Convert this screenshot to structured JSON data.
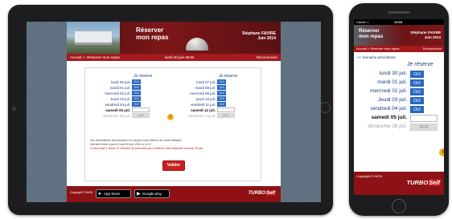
{
  "header": {
    "title_line1": "Réserver",
    "title_line2": "mon repas",
    "user_name": "Stéphane FAIVRE",
    "user_period": "Juin 2014"
  },
  "nav": {
    "home": "Accueil",
    "sep": ">",
    "current": "Réserver mon repas",
    "date": "lundi 30 juin 09:56",
    "logout": "Déconnexion"
  },
  "reservation": {
    "column_header": "Je réserve",
    "choice_yes": "OUI",
    "choice_no": "NON",
    "left_column": [
      {
        "day": "lundi 30 juin",
        "choice": "OUI"
      },
      {
        "day": "mardi 01 juil.",
        "choice": "OUI"
      },
      {
        "day": "mercredi 02 juil.",
        "choice": "OUI"
      },
      {
        "day": "Jeudi 03 juil.",
        "choice": "OUI"
      },
      {
        "day": "vendredi 04 juil.",
        "choice": "OUI"
      },
      {
        "day": "samedi 05 juil.",
        "choice": ""
      },
      {
        "day": "dimanche 06 juil.",
        "choice": "NON"
      }
    ],
    "right_column": [
      {
        "day": "lundi 07 juil.",
        "choice": "OUI"
      },
      {
        "day": "mardi 08 juil.",
        "choice": "OUI"
      },
      {
        "day": "mercredi 09 juil.",
        "choice": "OUI"
      },
      {
        "day": "jeudi 10 juil.",
        "choice": "OUI"
      },
      {
        "day": "vendredi 11 juil.",
        "choice": "OUI"
      },
      {
        "day": "samedi 12 juil.",
        "choice": ""
      },
      {
        "day": "dimanche 13 juil.",
        "choice": "NON"
      }
    ],
    "info_symbol": "i",
    "notes": [
      "Vos réservations seront prises en compte sous réserve de solde suffisant",
      "Dernière mise à jour le lundi 30 juin 2014 à 12:47",
      "Il vous reste 1 heure 37 minutes 02 secondes pour réserver votre déjeuner du lundi 30 juin"
    ],
    "submit_label": "Valider"
  },
  "footer": {
    "copyright": "Copyright © INCB",
    "appstore": "App Store",
    "googleplay": "Google play",
    "logo_main": "TURBO",
    "logo_sub": "Self"
  },
  "phone": {
    "carrier": "Carrier ≈",
    "time": "13:03",
    "nav_home": "Accueil",
    "nav_current": "Réserver mon repas",
    "logout": "Déconnexion",
    "prev_week": "<< Semaine précédente",
    "rows": [
      {
        "day": "lundi 30 juil.",
        "choice": "OUI"
      },
      {
        "day": "mardi 01 juil.",
        "choice": "OUI"
      },
      {
        "day": "mercredi 02 juil.",
        "choice": "OUI"
      },
      {
        "day": "Jeudi 03 juil.",
        "choice": "OUI"
      },
      {
        "day": "vendredi 04 juil.",
        "choice": "OUI"
      },
      {
        "day": "samedi 05 juil.",
        "choice": ""
      },
      {
        "day": "dimanche 06 juil.",
        "choice": "NON"
      }
    ],
    "copyright": "Copyright © INCB"
  }
}
